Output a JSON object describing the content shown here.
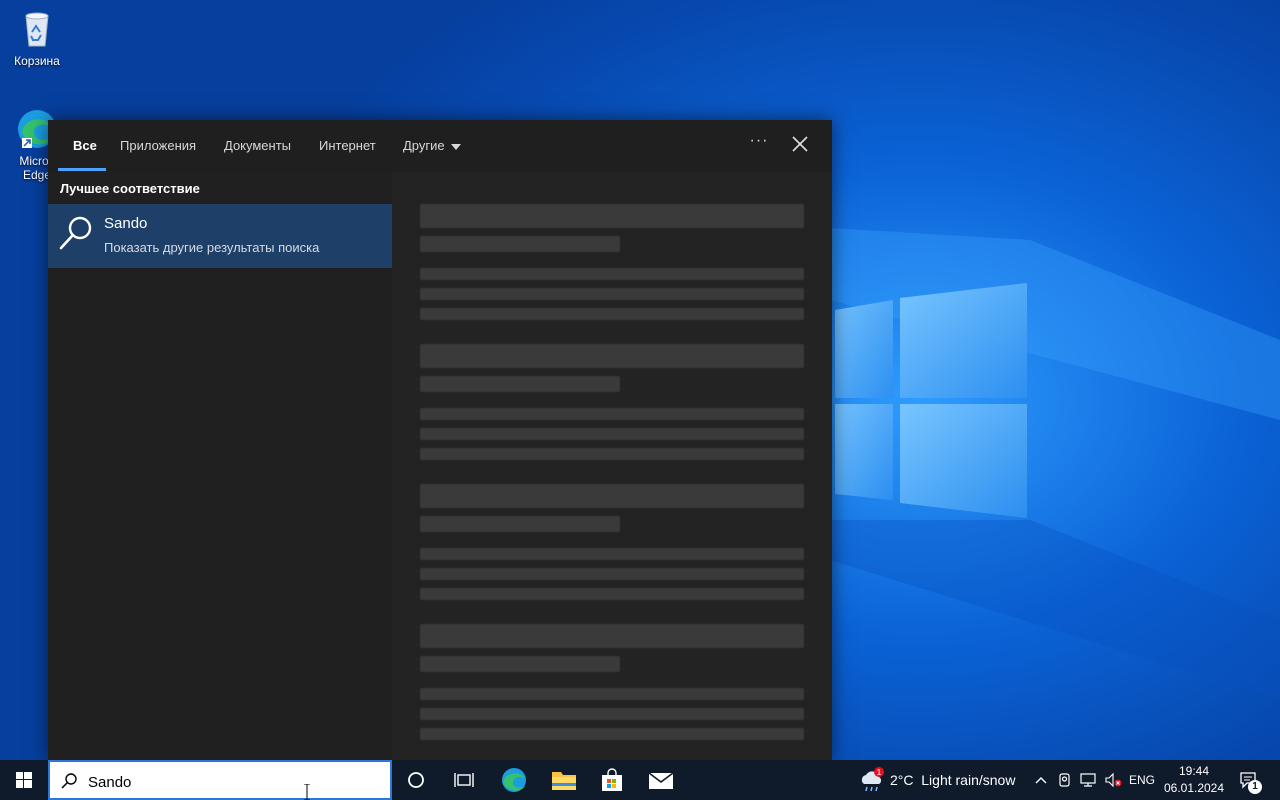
{
  "desktop": {
    "icons": [
      {
        "label": "Корзина"
      },
      {
        "label": "Microsoft Edge",
        "visible_label_line1": "Micros",
        "visible_label_line2": "Edge"
      }
    ]
  },
  "search_panel": {
    "tabs": [
      {
        "label": "Все",
        "active": true
      },
      {
        "label": "Приложения"
      },
      {
        "label": "Документы"
      },
      {
        "label": "Интернет"
      },
      {
        "label": "Другие"
      }
    ],
    "more_options_label": "···",
    "best_match_heading": "Лучшее соответствие",
    "best_match": {
      "title": "Sando",
      "subtitle": "Показать другие результаты поиска"
    }
  },
  "taskbar": {
    "search_value": "Sando",
    "weather": {
      "badge": "1",
      "text": "2°C  Light rain/snow"
    },
    "language": "ENG",
    "time": "19:44",
    "date": "06.01.2024",
    "notification_count": "1"
  },
  "colors": {
    "accent": "#4ba3ff",
    "selected_item": "#1e4068",
    "panel_bg": "#202020",
    "taskbar_bg": "#0f1a2b"
  }
}
